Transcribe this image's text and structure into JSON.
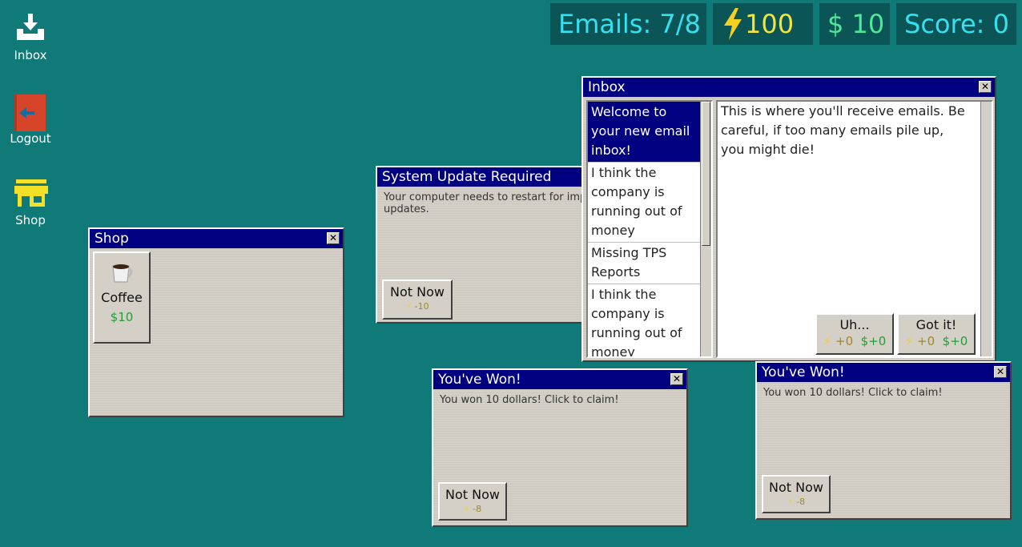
{
  "desktop": {
    "icons": [
      {
        "label": "Inbox",
        "icon": "inbox-download-icon"
      },
      {
        "label": "Logout",
        "icon": "logout-arrow-icon"
      },
      {
        "label": "Shop",
        "icon": "shop-storefront-icon"
      }
    ]
  },
  "hud": {
    "emails": "Emails: 7/8",
    "energy": "100",
    "money": "$ 10",
    "score": "Score: 0"
  },
  "shop": {
    "title": "Shop",
    "items": [
      {
        "name": "Coffee",
        "price": "$10",
        "icon": "coffee-cup-icon"
      }
    ]
  },
  "update": {
    "title": "System Update Required",
    "body": "Your computer needs to restart for important updates.",
    "button": {
      "label": "Not Now",
      "cost": "-10"
    }
  },
  "inbox": {
    "title": "Inbox",
    "emails": [
      {
        "subject": "Welcome to your new email inbox!",
        "selected": true
      },
      {
        "subject": "I think the company is running out of money"
      },
      {
        "subject": "Missing TPS Reports"
      },
      {
        "subject": "I think the company is running out of money"
      }
    ],
    "body": "This is where you'll receive emails. Be careful, if too many emails pile up, you might die!",
    "replies": [
      {
        "label": "Uh...",
        "energy": "+0",
        "money": "$+0"
      },
      {
        "label": "Got it!",
        "energy": "+0",
        "money": "$+0"
      }
    ]
  },
  "won_popups": [
    {
      "title": "You've Won!",
      "body": "You won 10 dollars! Click to claim!",
      "button": {
        "label": "Not Now",
        "cost": "-8"
      }
    },
    {
      "title": "You've Won!",
      "body": "You won 10 dollars! Click to claim!",
      "button": {
        "label": "Not Now",
        "cost": "-8"
      }
    }
  ],
  "colors": {
    "desktop": "#0f7a78",
    "titlebar": "#000080",
    "window": "#d4d0c8",
    "energy": "#f5e53a",
    "money": "#4fe89a",
    "hud_text": "#35e0f0"
  }
}
